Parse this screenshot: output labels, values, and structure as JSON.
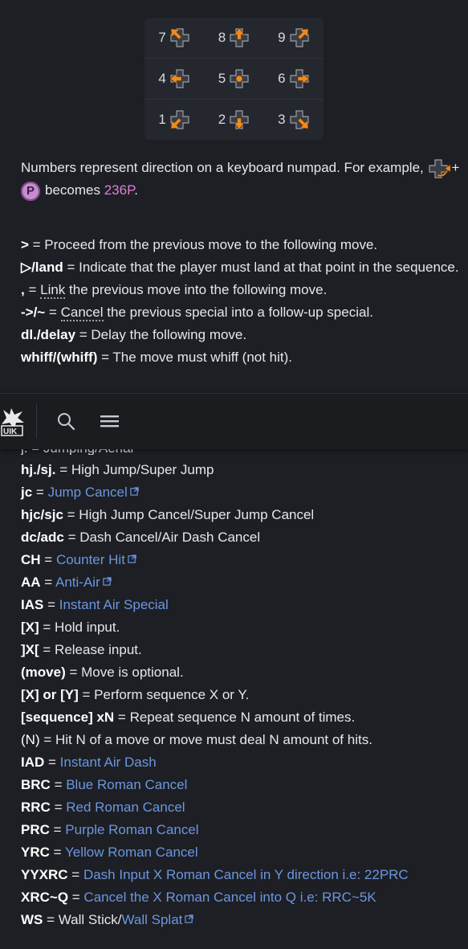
{
  "numpad": [
    {
      "num": "7",
      "icon": "dpad-up-left-icon"
    },
    {
      "num": "8",
      "icon": "dpad-up-icon"
    },
    {
      "num": "9",
      "icon": "dpad-up-right-icon"
    },
    {
      "num": "4",
      "icon": "dpad-left-icon"
    },
    {
      "num": "5",
      "icon": "dpad-neutral-icon"
    },
    {
      "num": "6",
      "icon": "dpad-right-icon"
    },
    {
      "num": "1",
      "icon": "dpad-down-left-icon"
    },
    {
      "num": "2",
      "icon": "dpad-down-icon"
    },
    {
      "num": "3",
      "icon": "dpad-down-right-icon"
    }
  ],
  "intro": {
    "text": "Numbers represent direction on a keyboard numpad. For example,",
    "plus": "+",
    "button": "P",
    "becomes": "becomes",
    "result": "236P",
    "period": "."
  },
  "rules": [
    {
      "key": ">",
      "text": " = Proceed from the previous move to the following move."
    },
    {
      "key": "▷/land",
      "text": " = Indicate that the player must land at that point in the sequence."
    },
    {
      "key": ",",
      "eq": " = ",
      "term": "Link",
      "text": " the previous move into the following move."
    },
    {
      "key": "->/~",
      "eq": " = ",
      "term": "Cancel",
      "text": " the previous special into a follow-up special."
    },
    {
      "key": "dl./delay",
      "text": " = Delay the following move."
    },
    {
      "key": "whiff/(whiff)",
      "text": " = The move must whiff (not hit)."
    }
  ],
  "clipped_line": "j. = Jumping/Aerial",
  "notation": [
    {
      "key": "hj./sj.",
      "text": " = High Jump/Super Jump"
    },
    {
      "key": "jc",
      "text": " = ",
      "link": "Jump Cancel",
      "ext": true
    },
    {
      "key": "hjc/sjc",
      "text": " = High Jump Cancel/Super Jump Cancel"
    },
    {
      "key": "dc/adc",
      "text": " = Dash Cancel/Air Dash Cancel"
    },
    {
      "key": "CH",
      "text": " = ",
      "link": "Counter Hit",
      "ext": true
    },
    {
      "key": "AA",
      "text": " = ",
      "link": "Anti-Air",
      "ext": true
    },
    {
      "key": "IAS",
      "text": " = ",
      "link": "Instant Air Special"
    },
    {
      "key": "[X]",
      "text": " = Hold input."
    },
    {
      "key": "]X[",
      "text": " = Release input."
    },
    {
      "key": "(move)",
      "text": " = Move is optional."
    },
    {
      "key": "[X] or [Y]",
      "text": " = Perform sequence X or Y."
    },
    {
      "key": "[sequence] xN",
      "text": " = Repeat sequence N amount of times."
    },
    {
      "key": "(N)",
      "text": " = Hit N of a move or move must deal N amount of hits.",
      "plainkey": true
    },
    {
      "key": "IAD",
      "text": " = ",
      "link": "Instant Air Dash"
    },
    {
      "key": "BRC",
      "text": " = ",
      "link": "Blue Roman Cancel"
    },
    {
      "key": "RRC",
      "text": " = ",
      "link": "Red Roman Cancel"
    },
    {
      "key": "PRC",
      "text": " = ",
      "link": "Purple Roman Cancel"
    },
    {
      "key": "YRC",
      "text": " = ",
      "link": "Yellow Roman Cancel"
    },
    {
      "key": "YYXRC",
      "text": " = ",
      "link": "Dash Input X Roman Cancel in Y direction i.e: 22PRC"
    },
    {
      "key": "XRC~Q",
      "text": " = ",
      "link": "Cancel the X Roman Cancel into Q i.e: RRC~5K"
    },
    {
      "key": "WS",
      "text": " = Wall Stick/",
      "link": "Wall Splat",
      "ext": true
    }
  ],
  "topbar": {
    "logo": "site-logo",
    "search_icon": "search-icon",
    "menu_icon": "menu-icon"
  },
  "colors": {
    "link": "#6c96de",
    "pink": "#e07fd8",
    "bg": "#1d1f24",
    "arrow": "#f08a1e"
  }
}
